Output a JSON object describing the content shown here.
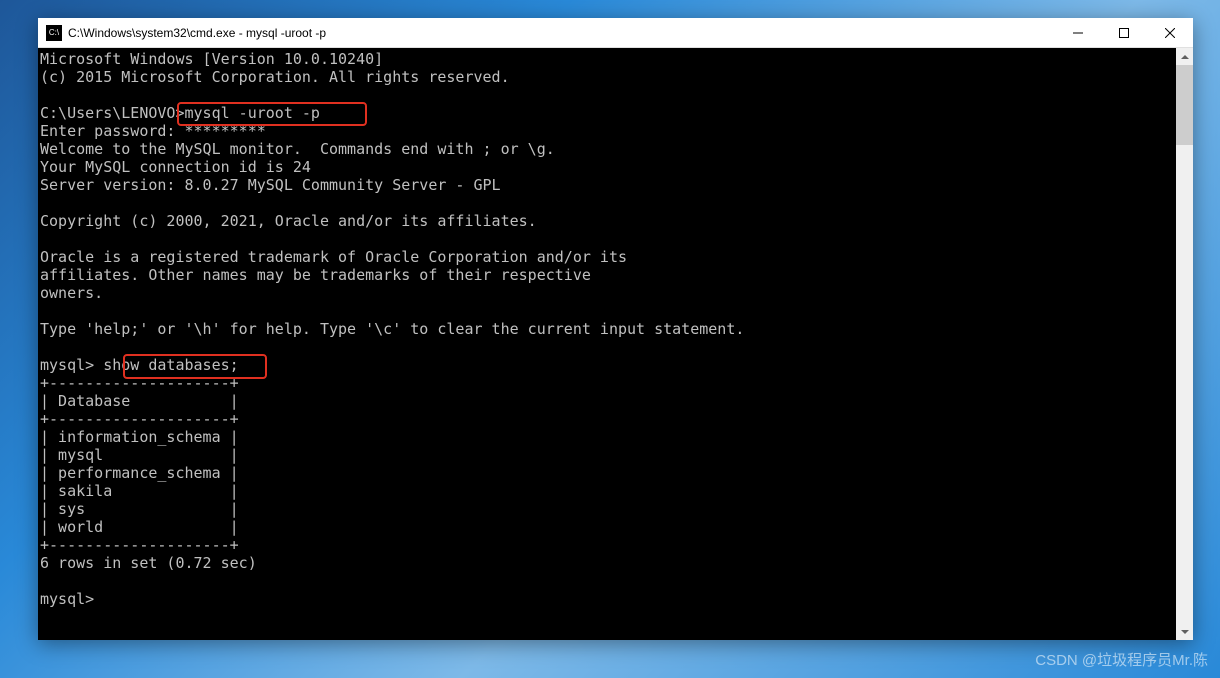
{
  "window": {
    "title": "C:\\Windows\\system32\\cmd.exe - mysql  -uroot -p",
    "icon_label": "C:\\"
  },
  "terminal": {
    "lines": {
      "l01": "Microsoft Windows [Version 10.0.10240]",
      "l02": "(c) 2015 Microsoft Corporation. All rights reserved.",
      "l03": "",
      "l04": "C:\\Users\\LENOVO>mysql -uroot -p",
      "l05": "Enter password: *********",
      "l06": "Welcome to the MySQL monitor.  Commands end with ; or \\g.",
      "l07": "Your MySQL connection id is 24",
      "l08": "Server version: 8.0.27 MySQL Community Server - GPL",
      "l09": "",
      "l10": "Copyright (c) 2000, 2021, Oracle and/or its affiliates.",
      "l11": "",
      "l12": "Oracle is a registered trademark of Oracle Corporation and/or its",
      "l13": "affiliates. Other names may be trademarks of their respective",
      "l14": "owners.",
      "l15": "",
      "l16": "Type 'help;' or '\\h' for help. Type '\\c' to clear the current input statement.",
      "l17": "",
      "l18": "mysql> show databases;",
      "l19": "+--------------------+",
      "l20": "| Database           |",
      "l21": "+--------------------+",
      "l22": "| information_schema |",
      "l23": "| mysql              |",
      "l24": "| performance_schema |",
      "l25": "| sakila             |",
      "l26": "| sys                |",
      "l27": "| world              |",
      "l28": "+--------------------+",
      "l29": "6 rows in set (0.72 sec)",
      "l30": "",
      "l31": "mysql>"
    }
  },
  "watermark": "CSDN @垃圾程序员Mr.陈"
}
